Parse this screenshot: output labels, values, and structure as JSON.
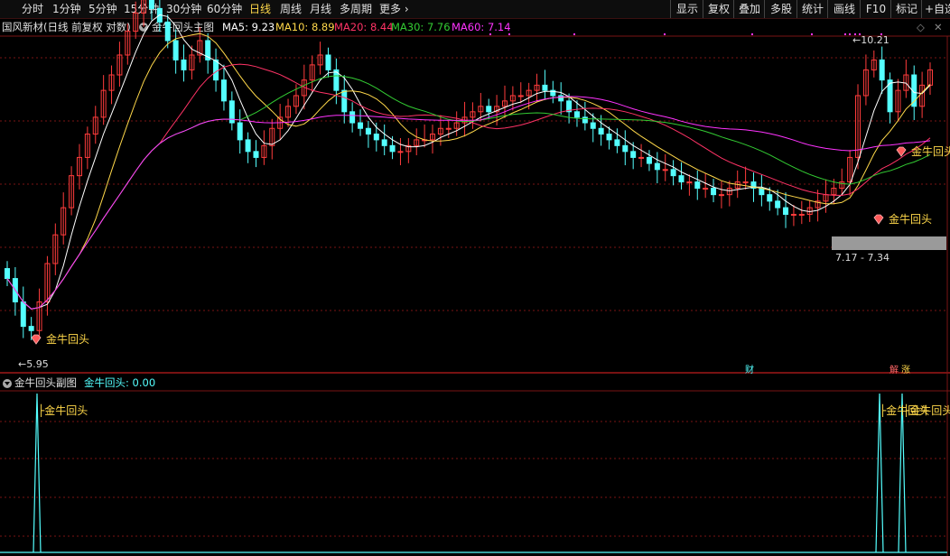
{
  "toolbar": {
    "periods": [
      "分时",
      "1分钟",
      "5分钟",
      "15分钟",
      "30分钟",
      "60分钟",
      "日线",
      "周线",
      "月线",
      "多周期",
      "更多"
    ],
    "active_period": "日线",
    "right_buttons": [
      "显示",
      "复权",
      "叠加",
      "多股",
      "统计",
      "画线",
      "F10",
      "标记",
      "+自选"
    ]
  },
  "main_info": {
    "stock": "国风新材(日线 前复权 对数)",
    "indicator": "金牛回头主图",
    "ma5": "MA5: 9.23",
    "ma10": "MA10: 8.89",
    "ma20": "MA20: 8.44",
    "ma30": "MA30: 7.76",
    "ma60": "MA60: 7.14"
  },
  "main_chart": {
    "high_label": "10.21",
    "low_label": "5.95",
    "range_label": "7.17 - 7.34",
    "signal_label": "金牛回头",
    "event_cai": "财",
    "event_jie": "解",
    "event_zhang": "涨"
  },
  "sub_info": {
    "title": "金牛回头副图",
    "value": "金牛回头: 0.00",
    "signal_label": "金牛回头"
  },
  "colors": {
    "up": "#ff3c3c",
    "down": "#54ffff",
    "ma5": "#ffffff",
    "ma10": "#ffd84a",
    "ma20": "#ff3366",
    "ma30": "#33cc33",
    "ma60": "#ff33ff",
    "grid": "#7a1515"
  },
  "chart_data": {
    "type": "candlestick",
    "closes": [
      6.6,
      6.3,
      6.0,
      5.95,
      6.3,
      6.8,
      7.2,
      7.6,
      8.1,
      8.4,
      8.8,
      9.1,
      9.6,
      9.9,
      10.3,
      10.8,
      11.2,
      11.5,
      11.3,
      11.0,
      10.6,
      10.2,
      10.0,
      10.3,
      10.6,
      10.2,
      9.8,
      9.4,
      9.0,
      8.7,
      8.5,
      8.4,
      8.6,
      8.9,
      9.1,
      9.3,
      9.5,
      9.8,
      10.1,
      10.3,
      10.0,
      9.6,
      9.2,
      9.0,
      8.9,
      8.8,
      8.7,
      8.6,
      8.5,
      8.5,
      8.6,
      8.7,
      8.7,
      8.8,
      8.9,
      8.9,
      9.0,
      9.1,
      9.2,
      9.3,
      9.2,
      9.3,
      9.4,
      9.5,
      9.5,
      9.6,
      9.7,
      9.6,
      9.5,
      9.4,
      9.2,
      9.1,
      9.0,
      8.9,
      8.8,
      8.7,
      8.6,
      8.5,
      8.4,
      8.4,
      8.3,
      8.2,
      8.2,
      8.1,
      8.0,
      8.0,
      7.9,
      7.9,
      7.8,
      7.8,
      7.9,
      8.0,
      8.0,
      7.9,
      7.8,
      7.7,
      7.6,
      7.5,
      7.5,
      7.5,
      7.6,
      7.7,
      7.8,
      7.9,
      8.0,
      8.4,
      9.5,
      10.0,
      10.2,
      9.8,
      9.2,
      9.6,
      9.9,
      9.3,
      9.7,
      10.0
    ]
  }
}
